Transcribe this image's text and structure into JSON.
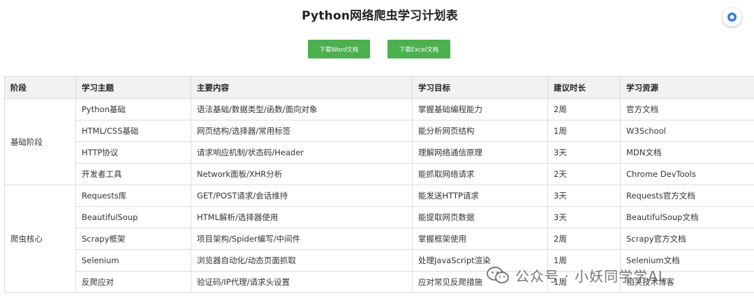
{
  "page": {
    "title": "Python网络爬虫学习计划表"
  },
  "actions": {
    "word_label": "下载Word文档",
    "excel_label": "下载Excel文档"
  },
  "icons": {
    "fab": "record-circle-icon",
    "watermark": "wechat-icon"
  },
  "colors": {
    "button_bg": "#4caf50",
    "fab_accent": "#3b7ddd",
    "header_bg": "#f2f2f2",
    "border": "#dcdcdc"
  },
  "table": {
    "headers": [
      "阶段",
      "学习主题",
      "主要内容",
      "学习目标",
      "建议时长",
      "学习资源"
    ],
    "groups": [
      {
        "stage": "基础阶段",
        "rows": [
          [
            "Python基础",
            "语法基础/数据类型/函数/面向对象",
            "掌握基础编程能力",
            "2周",
            "官方文档"
          ],
          [
            "HTML/CSS基础",
            "网页结构/选择器/常用标签",
            "能分析网页结构",
            "1周",
            "W3School"
          ],
          [
            "HTTP协议",
            "请求响应机制/状态码/Header",
            "理解网络通信原理",
            "3天",
            "MDN文档"
          ],
          [
            "开发者工具",
            "Network面板/XHR分析",
            "能抓取网络请求",
            "2天",
            "Chrome DevTools"
          ]
        ]
      },
      {
        "stage": "爬虫核心",
        "rows": [
          [
            "Requests库",
            "GET/POST请求/会话维持",
            "能发送HTTP请求",
            "3天",
            "Requests官方文档"
          ],
          [
            "BeautifulSoup",
            "HTML解析/选择器使用",
            "能提取网页数据",
            "3天",
            "BeautifulSoup文档"
          ],
          [
            "Scrapy框架",
            "项目架构/Spider编写/中间件",
            "掌握框架使用",
            "2周",
            "Scrapy官方文档"
          ],
          [
            "Selenium",
            "浏览器自动化/动态页面抓取",
            "处理JavaScript渲染",
            "1周",
            "Selenium文档"
          ],
          [
            "反爬应对",
            "验证码/IP代理/请求头设置",
            "应对常见反爬措施",
            "1周",
            "相关技术博客"
          ]
        ]
      }
    ]
  },
  "watermark": {
    "text": "公众号 · 小妖同学学AI"
  }
}
